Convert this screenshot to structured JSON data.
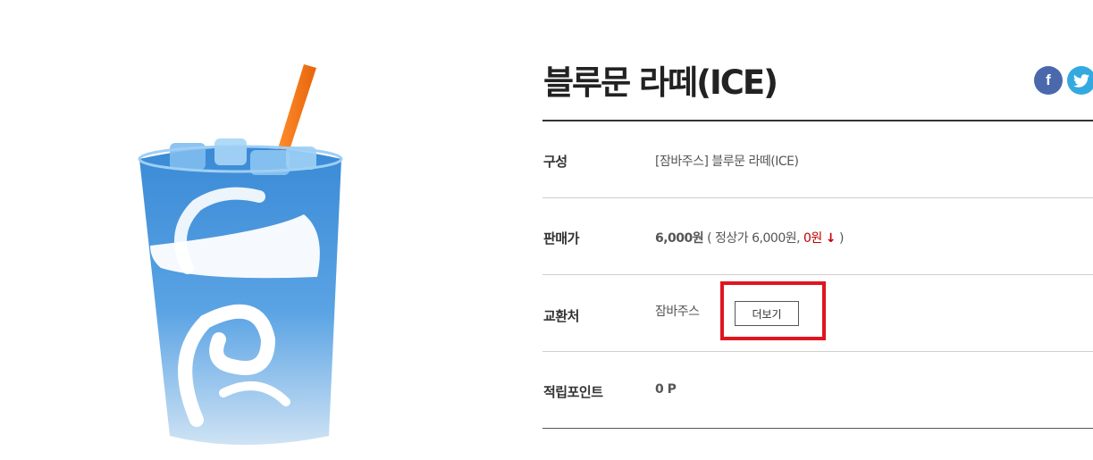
{
  "product": {
    "title": "블루문 라떼(ICE)",
    "image_alt": "blue-moon-latte-ice-cup"
  },
  "share": {
    "facebook_icon": "facebook-icon",
    "facebook_glyph": "f",
    "twitter_icon": "twitter-icon"
  },
  "details": {
    "composition": {
      "label": "구성",
      "value": "[잠바주스] 블루문 라떼(ICE)"
    },
    "price": {
      "label": "판매가",
      "sale_price": "6,000원",
      "open_paren": "( 정상가",
      "regular_price": "6,000원,",
      "discount": "0원",
      "arrow": "↓",
      "close_paren": ")"
    },
    "exchange": {
      "label": "교환처",
      "value": "잠바주스",
      "more_button": "더보기"
    },
    "points": {
      "label": "적립포인트",
      "value": "0 P"
    }
  },
  "colors": {
    "highlight": "#e0151f",
    "discount": "#c00000",
    "facebook": "#4a69ad",
    "twitter": "#34a9e0"
  }
}
